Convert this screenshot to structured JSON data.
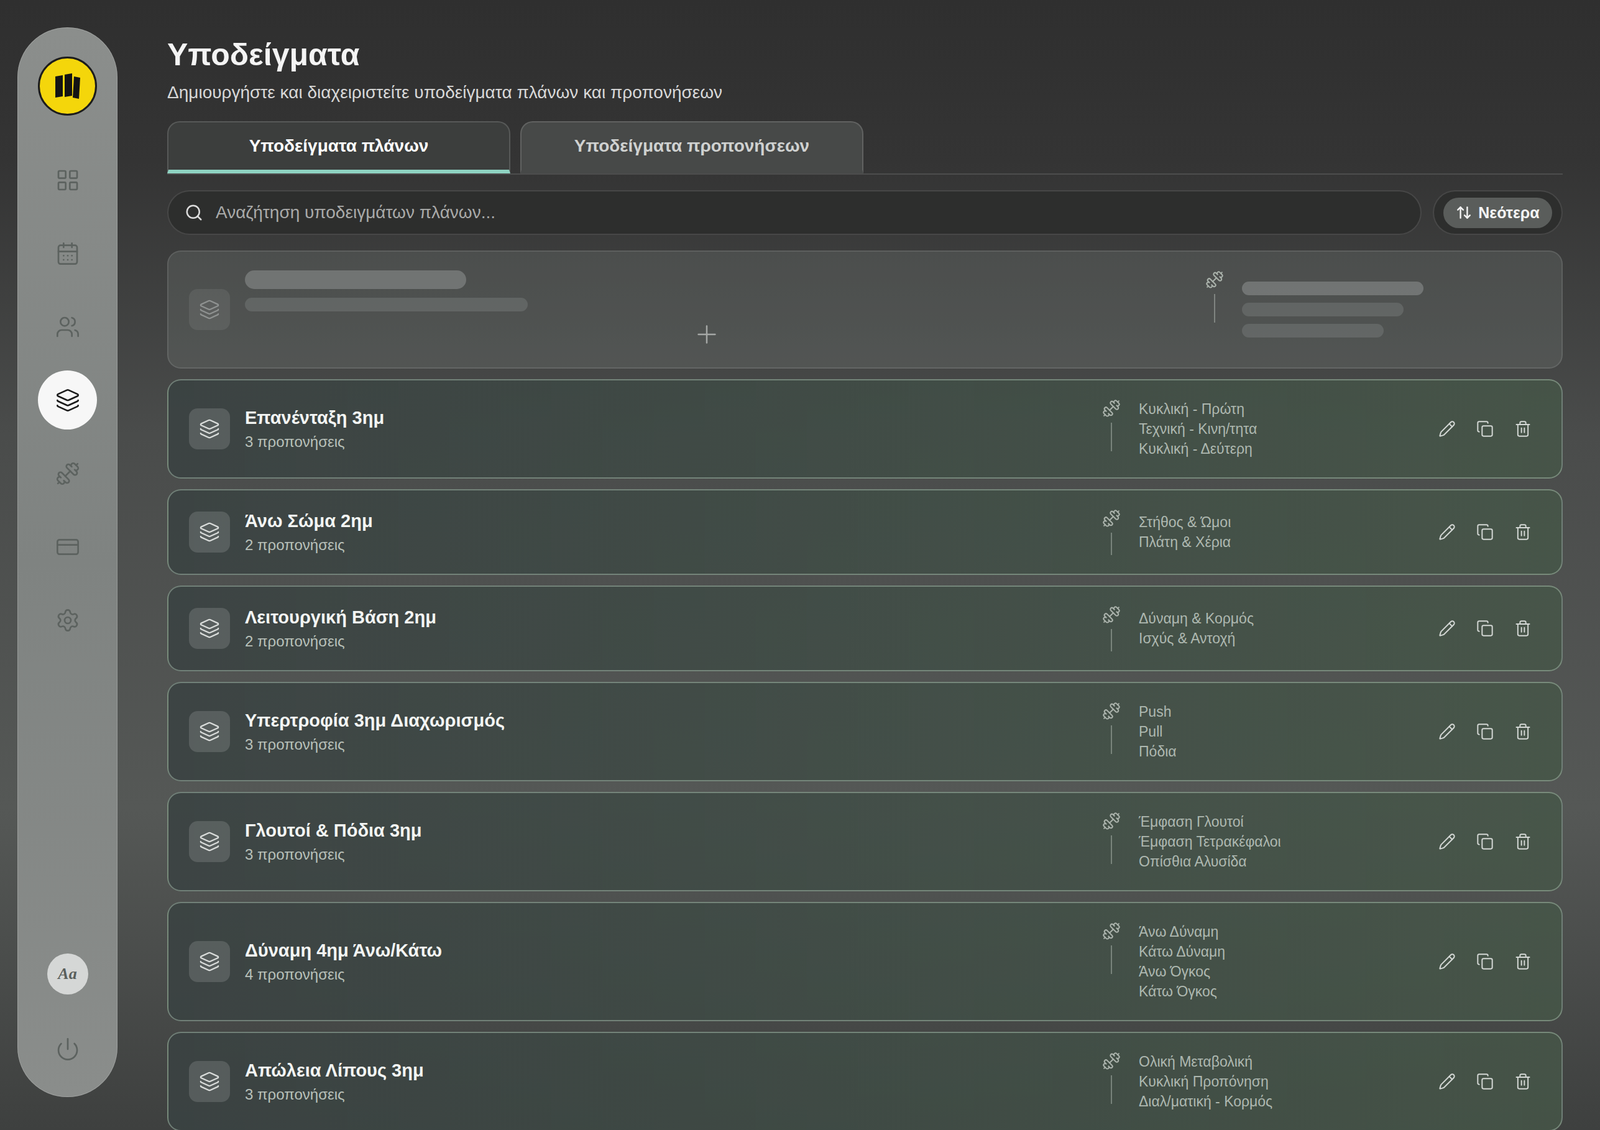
{
  "page": {
    "title": "Υποδείγματα",
    "subtitle": "Δημιουργήστε και διαχειριστείτε υποδείγματα πλάνων και προπονήσεων"
  },
  "sidebar": {
    "items": [
      {
        "selected": false
      },
      {
        "selected": false
      },
      {
        "selected": false
      },
      {
        "selected": true
      },
      {
        "selected": false
      },
      {
        "selected": false
      },
      {
        "selected": false
      }
    ],
    "font_button": "Aa"
  },
  "tabs": [
    {
      "label": "Υποδείγματα πλάνων",
      "selected": true
    },
    {
      "label": "Υποδείγματα προπονήσεων",
      "selected": false
    }
  ],
  "search": {
    "placeholder": "Αναζήτηση υποδειγμάτων πλάνων..."
  },
  "sort": {
    "label": "Νεότερα"
  },
  "templates": [
    {
      "name": "Επανένταξη 3ημ",
      "count": "3 προπονήσεις",
      "workouts": [
        "Κυκλική - Πρώτη",
        "Τεχνική - Κινη/τητα",
        "Κυκλική - Δεύτερη"
      ]
    },
    {
      "name": "Άνω Σώμα 2ημ",
      "count": "2 προπονήσεις",
      "workouts": [
        "Στήθος & Ώμοι",
        "Πλάτη & Χέρια"
      ]
    },
    {
      "name": "Λειτουργική Βάση 2ημ",
      "count": "2 προπονήσεις",
      "workouts": [
        "Δύναμη & Κορμός",
        "Ισχύς & Αντοχή"
      ]
    },
    {
      "name": "Υπερτροφία 3ημ Διαχωρισμός",
      "count": "3 προπονήσεις",
      "workouts": [
        "Push",
        "Pull",
        "Πόδια"
      ]
    },
    {
      "name": "Γλουτοί & Πόδια 3ημ",
      "count": "3 προπονήσεις",
      "workouts": [
        "Έμφαση Γλουτοί",
        "Έμφαση Τετρακέφαλοι",
        "Οπίσθια Αλυσίδα"
      ]
    },
    {
      "name": "Δύναμη 4ημ Άνω/Κάτω",
      "count": "4 προπονήσεις",
      "workouts": [
        "Άνω Δύναμη",
        "Κάτω Δύναμη",
        "Άνω Όγκος",
        "Κάτω Όγκος"
      ]
    },
    {
      "name": "Απώλεια Λίπους 3ημ",
      "count": "3 προπονήσεις",
      "workouts": [
        "Ολική Μεταβολική",
        "Κυκλική Προπόνηση",
        "Διαλ/ματική - Κορμός"
      ]
    }
  ]
}
